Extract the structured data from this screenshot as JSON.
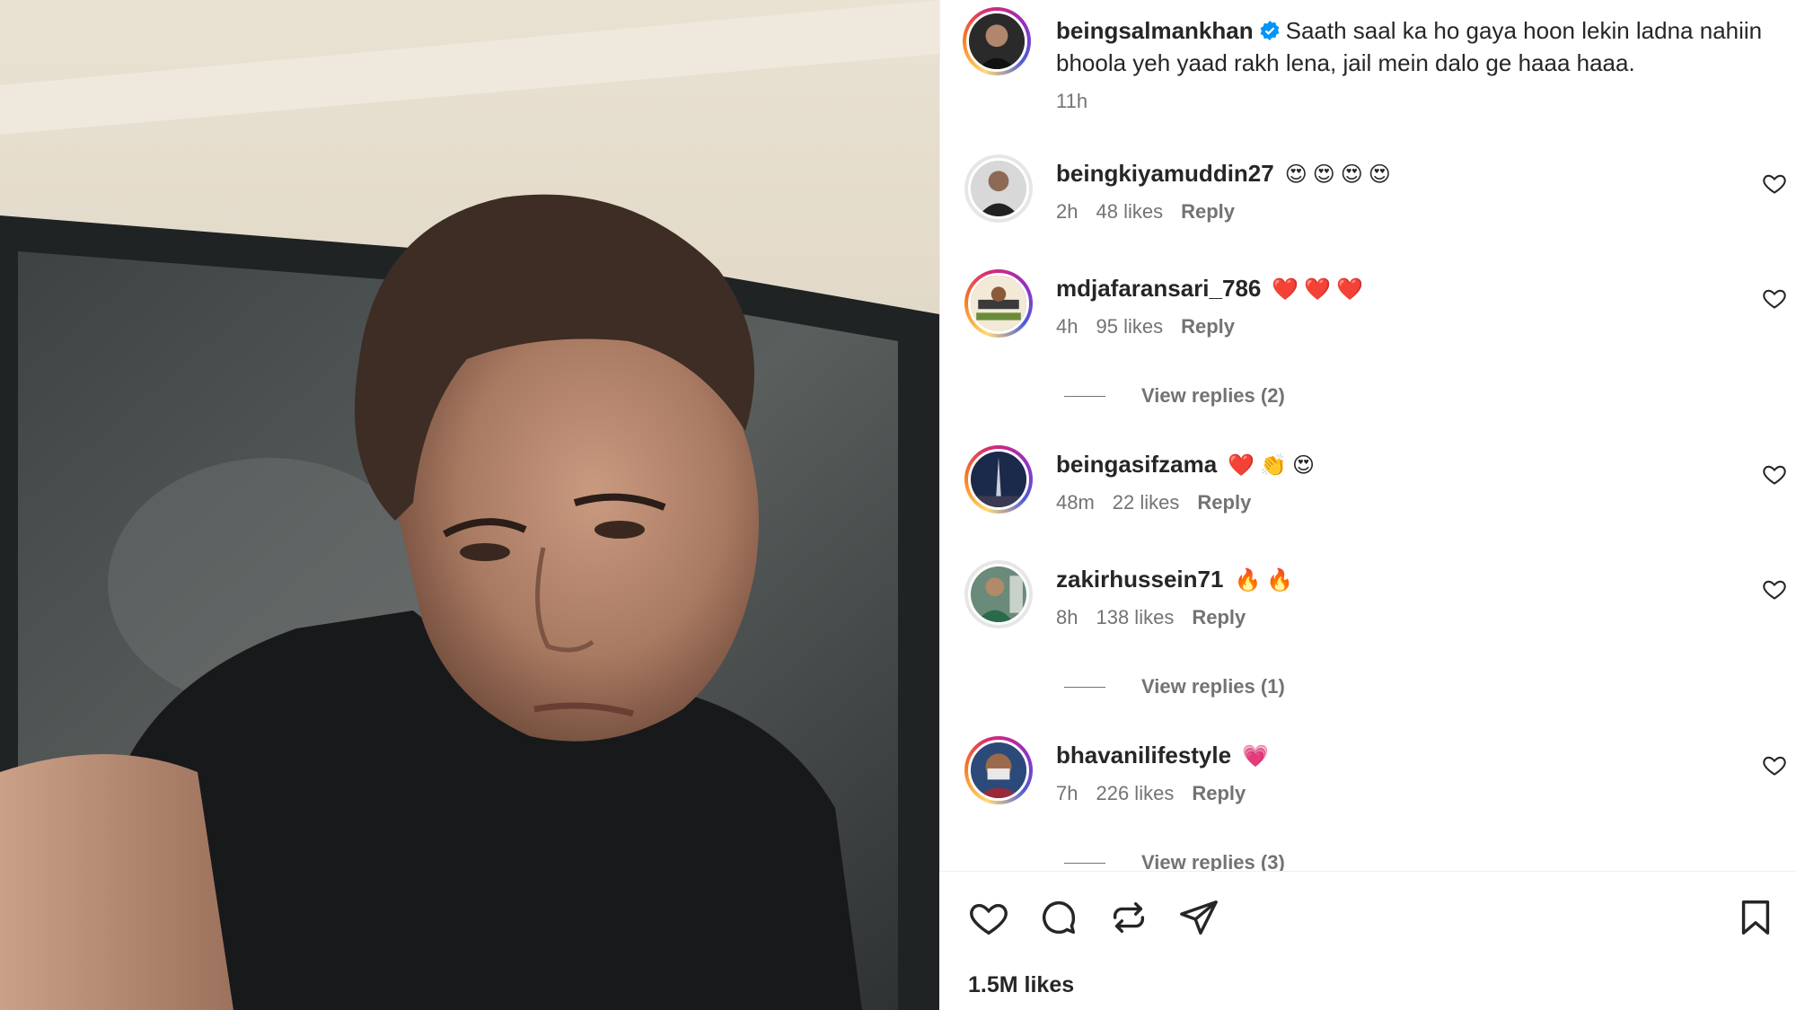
{
  "post": {
    "author": "beingsalmankhan",
    "verified": true,
    "caption": "Saath saal ka ho gaya hoon lekin ladna nahiin bhoola yeh yaad rakh lena, jail mein dalo ge haaa haaa.",
    "time": "11h"
  },
  "comments": [
    {
      "user": "beingkiyamuddin27",
      "emoji": "😍😍😍😍",
      "time": "2h",
      "likes": "48 likes",
      "reply": "Reply",
      "ring": false
    },
    {
      "user": "mdjafaransari_786",
      "emoji": "❤️❤️❤️",
      "time": "4h",
      "likes": "95 likes",
      "reply": "Reply",
      "ring": true,
      "view_replies": "View replies (2)"
    },
    {
      "user": "beingasifzama",
      "emoji": "❤️👏😍",
      "time": "48m",
      "likes": "22 likes",
      "reply": "Reply",
      "ring": true
    },
    {
      "user": "zakirhussein71",
      "emoji": "🔥🔥",
      "time": "8h",
      "likes": "138 likes",
      "reply": "Reply",
      "ring": false,
      "view_replies": "View replies (1)"
    },
    {
      "user": "bhavanilifestyle",
      "emoji": "💗",
      "time": "7h",
      "likes": "226 likes",
      "reply": "Reply",
      "ring": true,
      "view_replies": "View replies (3)"
    }
  ],
  "actions": {
    "icons": [
      "heart-icon",
      "comment-icon",
      "repost-icon",
      "share-icon",
      "bookmark-icon"
    ],
    "likes": "1.5M likes"
  },
  "colors": {
    "verified": "#0095f6",
    "meta_text": "#737373",
    "text": "#262626"
  }
}
